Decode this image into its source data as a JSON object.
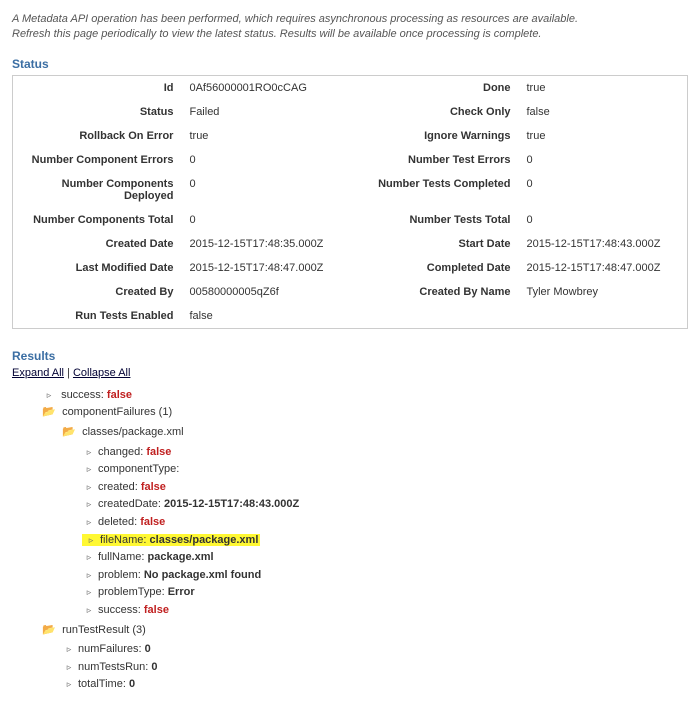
{
  "intro": {
    "line1": "A Metadata API operation has been performed, which requires asynchronous processing as resources are available.",
    "line2": "Refresh this page periodically to view the latest status. Results will be available once processing is complete."
  },
  "statusHeader": "Status",
  "status": {
    "id_l": "Id",
    "id_v": "0Af56000001RO0cCAG",
    "done_l": "Done",
    "done_v": "true",
    "status_l": "Status",
    "status_v": "Failed",
    "checkOnly_l": "Check Only",
    "checkOnly_v": "false",
    "rollback_l": "Rollback On Error",
    "rollback_v": "true",
    "ignoreWarn_l": "Ignore Warnings",
    "ignoreWarn_v": "true",
    "compErr_l": "Number Component Errors",
    "compErr_v": "0",
    "testErr_l": "Number Test Errors",
    "testErr_v": "0",
    "compDep_l": "Number Components Deployed",
    "compDep_v": "0",
    "testsComp_l": "Number Tests Completed",
    "testsComp_v": "0",
    "compTot_l": "Number Components Total",
    "compTot_v": "0",
    "testsTot_l": "Number Tests Total",
    "testsTot_v": "0",
    "created_l": "Created Date",
    "created_v": "2015-12-15T17:48:35.000Z",
    "start_l": "Start Date",
    "start_v": "2015-12-15T17:48:43.000Z",
    "modified_l": "Last Modified Date",
    "modified_v": "2015-12-15T17:48:47.000Z",
    "completed_l": "Completed Date",
    "completed_v": "2015-12-15T17:48:47.000Z",
    "createdBy_l": "Created By",
    "createdBy_v": "00580000005qZ6f",
    "createdByName_l": "Created By Name",
    "createdByName_v": "Tyler Mowbrey",
    "runTests_l": "Run Tests Enabled",
    "runTests_v": "false"
  },
  "resultsHeader": "Results",
  "controls": {
    "expandAll": "Expand All",
    "sep": " | ",
    "collapseAll": "Collapse All"
  },
  "tree": {
    "success_k": "success: ",
    "success_v": "false",
    "compFailures": "componentFailures (1)",
    "cf_path": "classes/package.xml",
    "cf_changed_k": "changed: ",
    "cf_changed_v": "false",
    "cf_compType_k": "componentType:",
    "cf_created_k": "created: ",
    "cf_created_v": "false",
    "cf_createdDate_k": "createdDate: ",
    "cf_createdDate_v": "2015-12-15T17:48:43.000Z",
    "cf_deleted_k": "deleted: ",
    "cf_deleted_v": "false",
    "cf_fileName_k": "fileName: ",
    "cf_fileName_v": "classes/package.xml",
    "cf_fullName_k": "fullName: ",
    "cf_fullName_v": "package.xml",
    "cf_problem_k": "problem: ",
    "cf_problem_v": "No package.xml found",
    "cf_problemType_k": "problemType: ",
    "cf_problemType_v": "Error",
    "cf_success_k": "success: ",
    "cf_success_v": "false",
    "runTestResult": "runTestResult (3)",
    "rt_numFailures_k": "numFailures: ",
    "rt_numFailures_v": "0",
    "rt_numTestsRun_k": "numTestsRun: ",
    "rt_numTestsRun_v": "0",
    "rt_totalTime_k": "totalTime: ",
    "rt_totalTime_v": "0"
  }
}
